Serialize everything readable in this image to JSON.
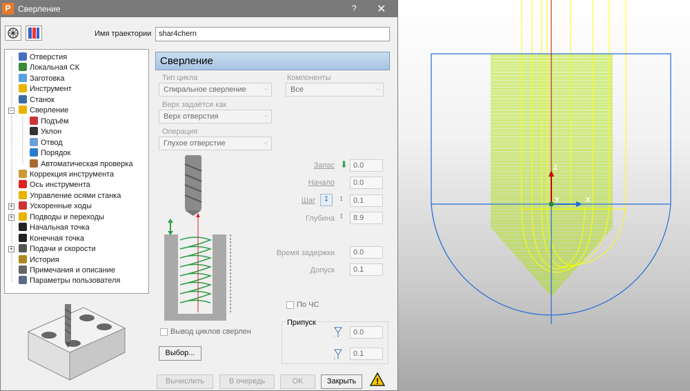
{
  "window": {
    "title": "Сверление",
    "logo_letter": "P",
    "help": "?",
    "close": "✕"
  },
  "toolbar": {
    "icons": [
      "wheel-icon",
      "tool-library-icon"
    ]
  },
  "path_name": {
    "label": "Имя траектории",
    "value": "shar4chern"
  },
  "tree": [
    {
      "label": "Отверстия"
    },
    {
      "label": "Локальная СК"
    },
    {
      "label": "Заготовка"
    },
    {
      "label": "Инструмент"
    },
    {
      "label": "Станок"
    },
    {
      "label": "Сверление"
    },
    {
      "label": "Подъём"
    },
    {
      "label": "Уклон"
    },
    {
      "label": "Отвод"
    },
    {
      "label": "Порядок"
    },
    {
      "label": "Автоматическая проверка"
    },
    {
      "label": "Коррекция инструмента"
    },
    {
      "label": "Ось инструмента"
    },
    {
      "label": "Управление осями станка"
    },
    {
      "label": "Ускоренные ходы"
    },
    {
      "label": "Подводы и переходы"
    },
    {
      "label": "Начальная точка"
    },
    {
      "label": "Конечная точка"
    },
    {
      "label": "Подачи и скорости"
    },
    {
      "label": "История"
    },
    {
      "label": "Примечания и описание"
    },
    {
      "label": "Параметры пользователя"
    }
  ],
  "panel": {
    "header": "Сверление",
    "cycle_type": {
      "label": "Тип цикла",
      "value": "Спиральное сверление"
    },
    "components": {
      "label": "Компоненты",
      "value": "Все"
    },
    "top_defined": {
      "label": "Верх задаётся как",
      "value": "Верх отверстия"
    },
    "operation": {
      "label": "Операция",
      "value": "Глухое отверстие"
    },
    "clearance": {
      "label": "Запас",
      "value": "0.0"
    },
    "start": {
      "label": "Начало",
      "value": "0.0"
    },
    "step": {
      "label": "Шаг",
      "value": "0.1"
    },
    "depth": {
      "label": "Глубина",
      "value": "8.9"
    },
    "dwell": {
      "label": "Время задержки",
      "value": "0.0"
    },
    "tolerance": {
      "label": "Допуск",
      "value": "0.1"
    },
    "clockwise": {
      "label": "По ЧС",
      "checked": false
    },
    "output_cycles": {
      "label": "Вывод циклов сверлен",
      "checked": false
    },
    "select_button": "Выбор...",
    "allowance": {
      "title": "Припуск",
      "radial": "0.0",
      "axial": "0.1"
    }
  },
  "buttons": {
    "calculate": "Вычислить",
    "queue": "В очередь",
    "ok": "OK",
    "close": "Закрыть"
  },
  "viewport": {
    "axis_z": "Z",
    "axis_y": "Y",
    "axis_x": "X",
    "colors": {
      "toolpath": "#a8e000",
      "tool": "#ffff00",
      "bbox": "#1e6bd6",
      "axis_z": "#cc0000",
      "axis_x": "#1e6bd6"
    }
  }
}
